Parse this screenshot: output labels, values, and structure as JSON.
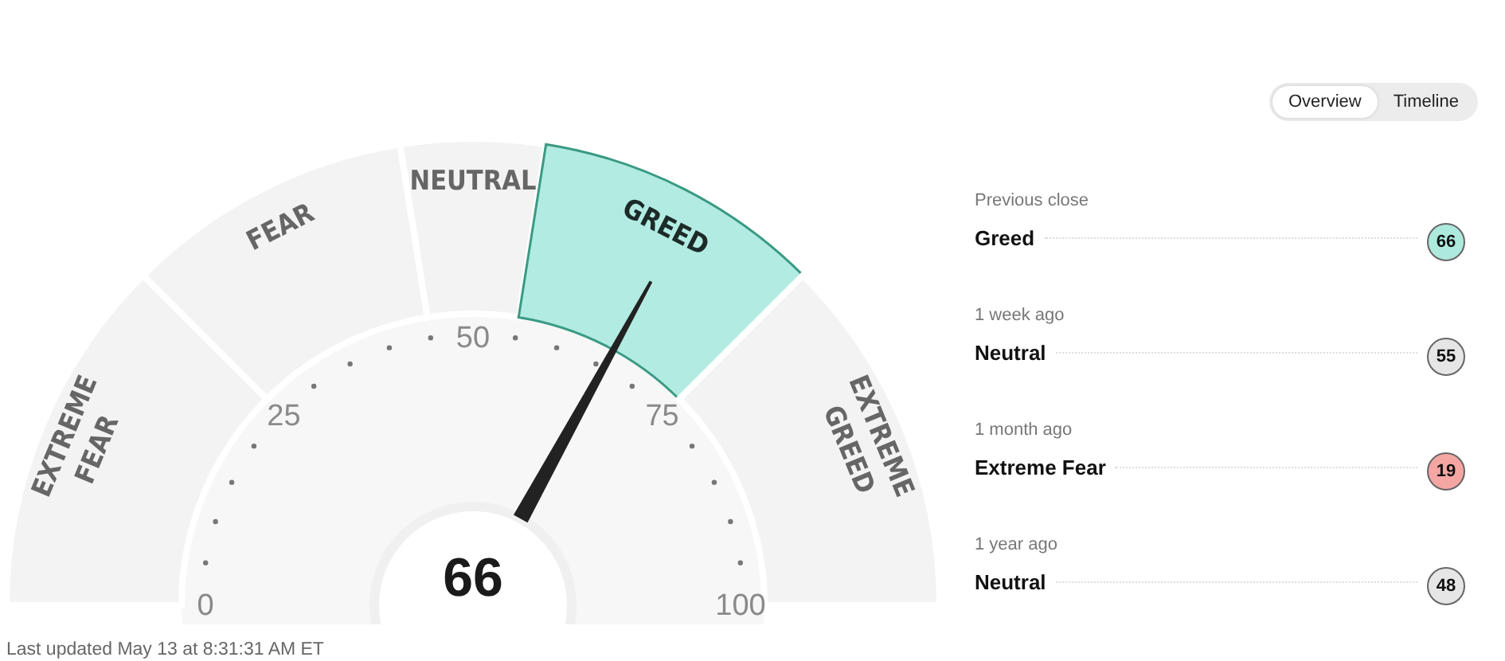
{
  "view_toggle": [
    {
      "label": "Overview",
      "selected": true
    },
    {
      "label": "Timeline",
      "selected": false
    }
  ],
  "gauge": {
    "segments": [
      {
        "lines": [
          "EXTREME",
          "FEAR"
        ],
        "selected": false
      },
      {
        "lines": [
          "FEAR"
        ],
        "selected": false
      },
      {
        "lines": [
          "NEUTRAL"
        ],
        "selected": false
      },
      {
        "lines": [
          "GREED"
        ],
        "selected": true
      },
      {
        "lines": [
          "EXTREME",
          "GREED"
        ],
        "selected": false
      }
    ],
    "ticks": [
      "0",
      "25",
      "50",
      "75",
      "100"
    ],
    "value": "66",
    "level": 0.66
  },
  "history": [
    {
      "period": "Previous close",
      "rating": "Greed",
      "score": "66",
      "color": "#aee9dd"
    },
    {
      "period": "1 week ago",
      "rating": "Neutral",
      "score": "55",
      "color": "#e6e6e6"
    },
    {
      "period": "1 month ago",
      "rating": "Extreme Fear",
      "score": "19",
      "color": "#f5a6a2"
    },
    {
      "period": "1 year ago",
      "rating": "Neutral",
      "score": "48",
      "color": "#e6e6e6"
    }
  ],
  "last_updated": "Last updated May 13 at 8:31:31 AM ET"
}
